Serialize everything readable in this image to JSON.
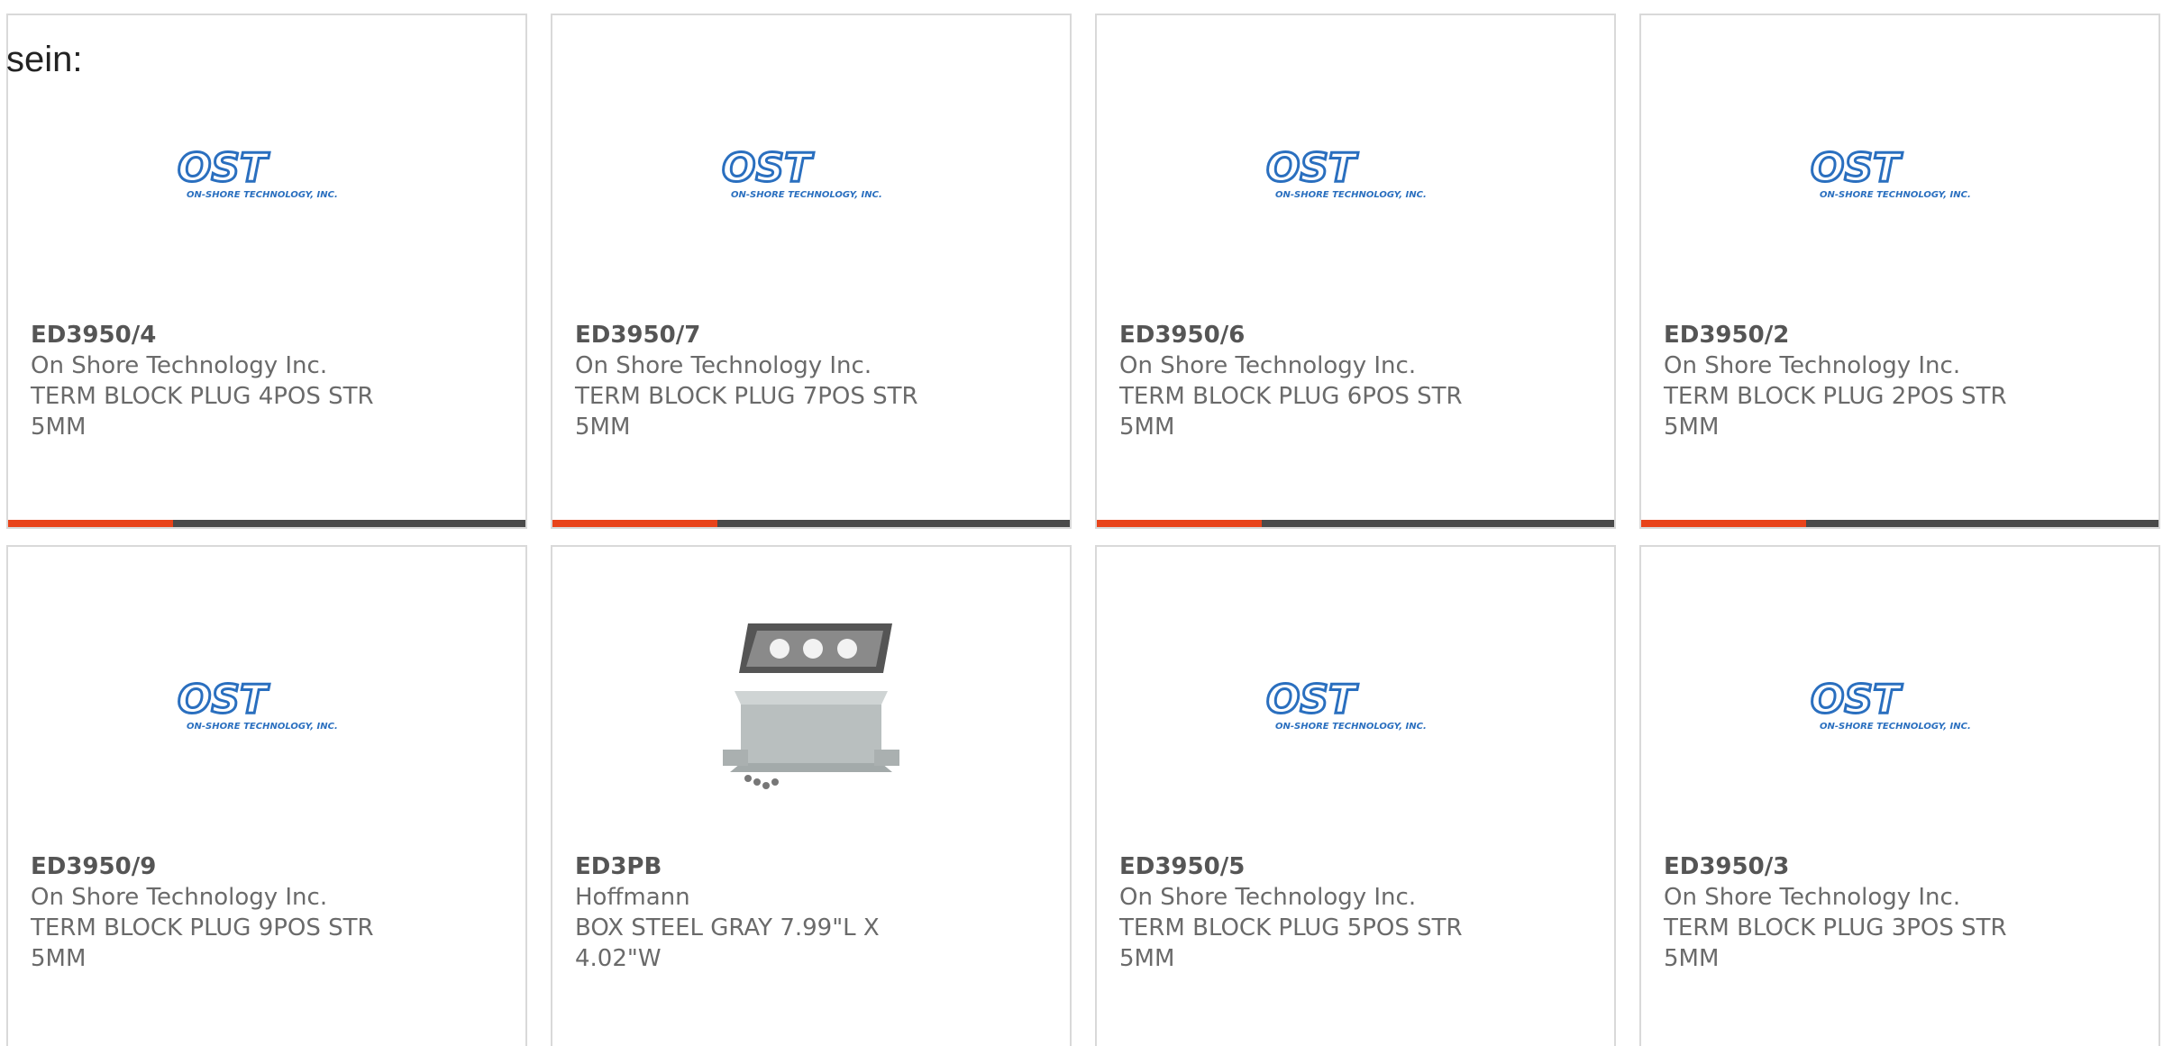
{
  "intro_text": "sein:",
  "colors": {
    "accent": "#e8431a",
    "bar_dark": "#4a4a4a",
    "ost_blue": "#2a6fbf"
  },
  "products": [
    {
      "part_number": "ED3950/4",
      "manufacturer": "On Shore Technology Inc.",
      "description": "TERM BLOCK PLUG 4POS STR 5MM",
      "image": "ost-logo"
    },
    {
      "part_number": "ED3950/7",
      "manufacturer": "On Shore Technology Inc.",
      "description": "TERM BLOCK PLUG 7POS STR 5MM",
      "image": "ost-logo"
    },
    {
      "part_number": "ED3950/6",
      "manufacturer": "On Shore Technology Inc.",
      "description": "TERM BLOCK PLUG 6POS STR 5MM",
      "image": "ost-logo"
    },
    {
      "part_number": "ED3950/2",
      "manufacturer": "On Shore Technology Inc.",
      "description": "TERM BLOCK PLUG 2POS STR 5MM",
      "image": "ost-logo"
    },
    {
      "part_number": "ED3950/9",
      "manufacturer": "On Shore Technology Inc.",
      "description": "TERM BLOCK PLUG 9POS STR 5MM",
      "image": "ost-logo"
    },
    {
      "part_number": "ED3PB",
      "manufacturer": "Hoffmann",
      "description": "BOX STEEL GRAY 7.99\"L X 4.02\"W",
      "image": "steel-box-photo"
    },
    {
      "part_number": "ED3950/5",
      "manufacturer": "On Shore Technology Inc.",
      "description": "TERM BLOCK PLUG 5POS STR 5MM",
      "image": "ost-logo"
    },
    {
      "part_number": "ED3950/3",
      "manufacturer": "On Shore Technology Inc.",
      "description": "TERM BLOCK PLUG 3POS STR 5MM",
      "image": "ost-logo"
    }
  ],
  "logo_text": {
    "mark": "OST",
    "subtitle": "ON-SHORE TECHNOLOGY, INC."
  }
}
